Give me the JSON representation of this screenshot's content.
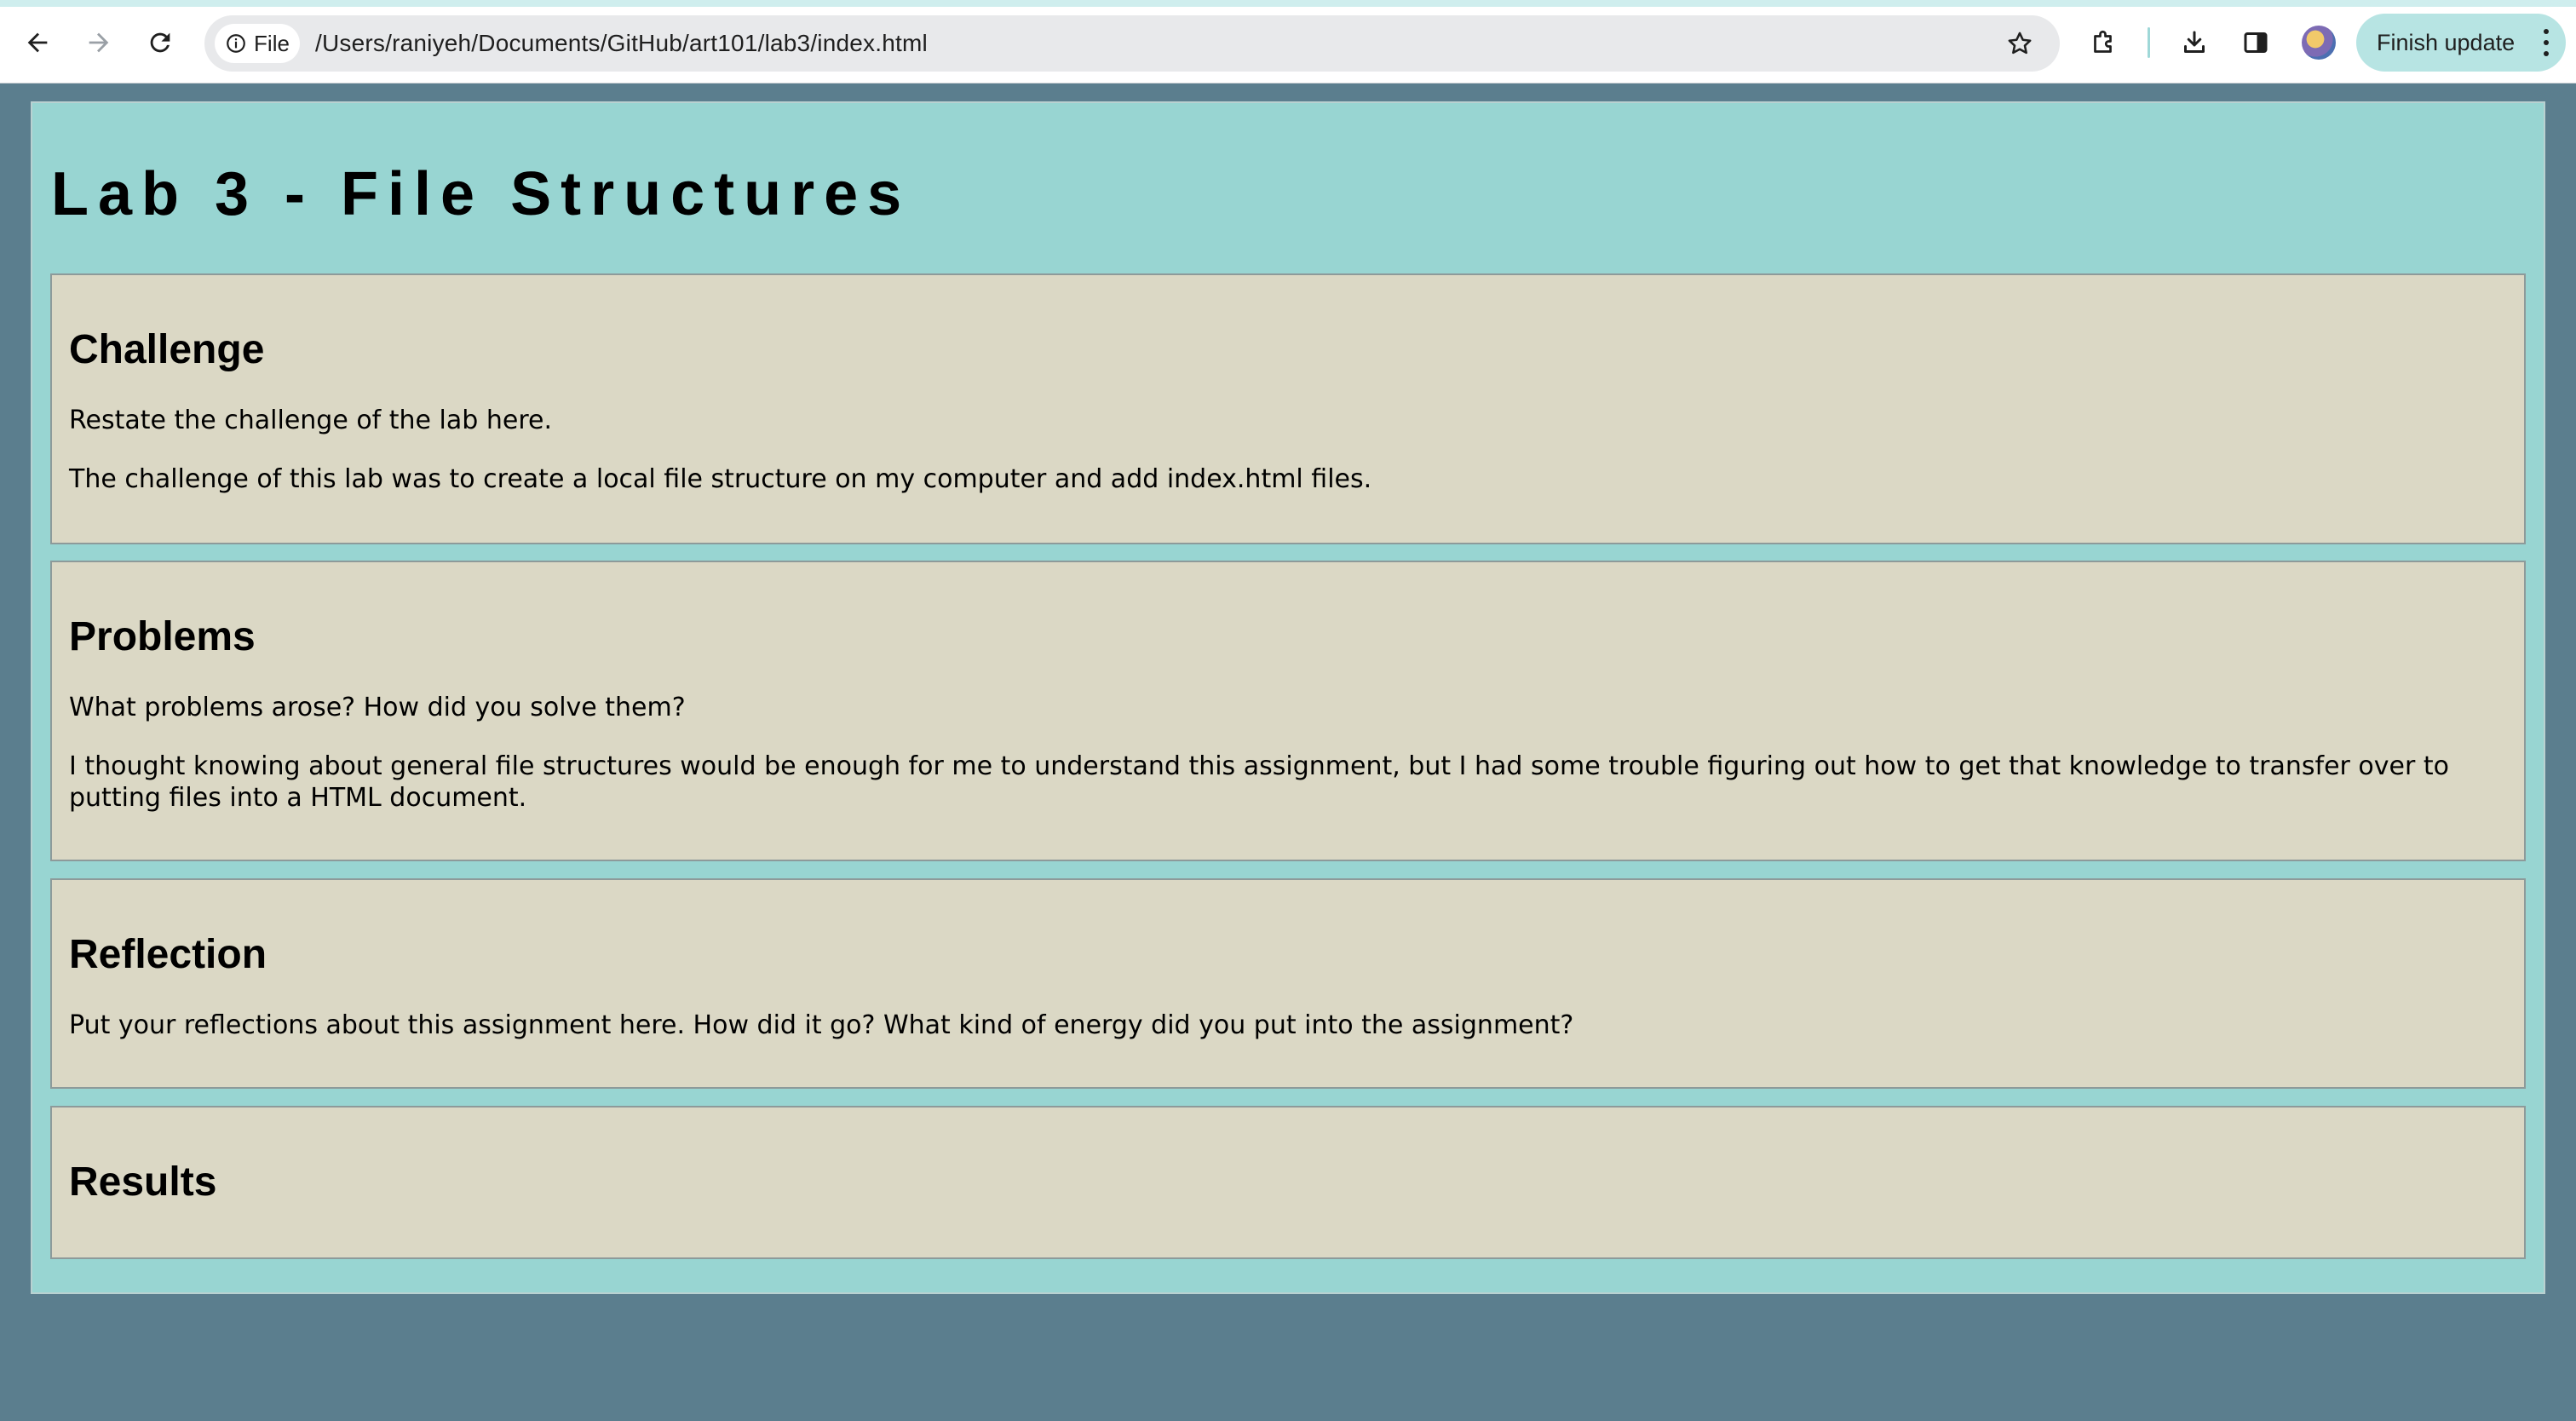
{
  "browser": {
    "chip_label": "File",
    "url": "/Users/raniyeh/Documents/GitHub/art101/lab3/index.html",
    "update_label": "Finish update",
    "accent_color": "#cfeeee"
  },
  "page": {
    "title": "Lab 3 - File Structures",
    "background": "#98d5d2",
    "sections": [
      {
        "heading": "Challenge",
        "paragraphs": [
          "Restate the challenge of the lab here.",
          "The challenge of this lab was to create a local file structure on my computer and add index.html files."
        ]
      },
      {
        "heading": "Problems",
        "paragraphs": [
          "What problems arose? How did you solve them?",
          "I thought knowing about general file structures would be enough for me to understand this assignment, but I had some trouble figuring out how to get that knowledge to transfer over to putting files into a HTML document."
        ]
      },
      {
        "heading": "Reflection",
        "paragraphs": [
          "Put your reflections about this assignment here. How did it go? What kind of energy did you put into the assignment?"
        ]
      },
      {
        "heading": "Results",
        "paragraphs": []
      }
    ]
  }
}
